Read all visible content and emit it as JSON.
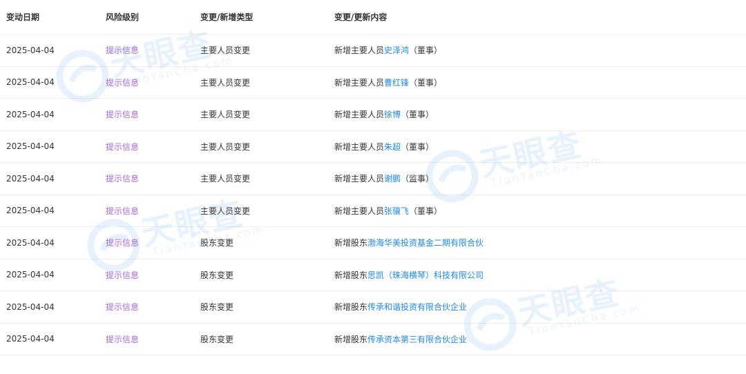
{
  "table": {
    "headers": {
      "date": "变动日期",
      "risk": "风险级别",
      "type": "变更/新增类型",
      "content": "变更/更新内容"
    },
    "rows": [
      {
        "date": "2025-04-04",
        "risk": "提示信息",
        "type": "主要人员变更",
        "prefix": "新增主要人员",
        "link": "史泽鸿",
        "suffix": "（董事）"
      },
      {
        "date": "2025-04-04",
        "risk": "提示信息",
        "type": "主要人员变更",
        "prefix": "新增主要人员",
        "link": "曹红锋",
        "suffix": "（董事）"
      },
      {
        "date": "2025-04-04",
        "risk": "提示信息",
        "type": "主要人员变更",
        "prefix": "新增主要人员",
        "link": "徐博",
        "suffix": "（董事）"
      },
      {
        "date": "2025-04-04",
        "risk": "提示信息",
        "type": "主要人员变更",
        "prefix": "新增主要人员",
        "link": "朱超",
        "suffix": "（董事）"
      },
      {
        "date": "2025-04-04",
        "risk": "提示信息",
        "type": "主要人员变更",
        "prefix": "新增主要人员",
        "link": "谢鹏",
        "suffix": "（监事）"
      },
      {
        "date": "2025-04-04",
        "risk": "提示信息",
        "type": "主要人员变更",
        "prefix": "新增主要人员",
        "link": "张骥飞",
        "suffix": "（董事）"
      },
      {
        "date": "2025-04-04",
        "risk": "提示信息",
        "type": "股东变更",
        "prefix": "新增股东",
        "link": "渤海华美投资基金二期有限合伙",
        "suffix": ""
      },
      {
        "date": "2025-04-04",
        "risk": "提示信息",
        "type": "股东变更",
        "prefix": "新增股东",
        "link": "思凯（珠海横琴）科技有限公司",
        "suffix": ""
      },
      {
        "date": "2025-04-04",
        "risk": "提示信息",
        "type": "股东变更",
        "prefix": "新增股东",
        "link": "传承和谐投资有限合伙企业",
        "suffix": ""
      },
      {
        "date": "2025-04-04",
        "risk": "提示信息",
        "type": "股东变更",
        "prefix": "新增股东",
        "link": "传承资本第三有限合伙企业",
        "suffix": ""
      }
    ]
  },
  "watermark": {
    "text": "天眼查",
    "subtext": "TianYanCha.com"
  },
  "colors": {
    "risk": "#a569d6",
    "link": "#1e88e5",
    "border": "#eeeeee",
    "text": "#333333"
  }
}
